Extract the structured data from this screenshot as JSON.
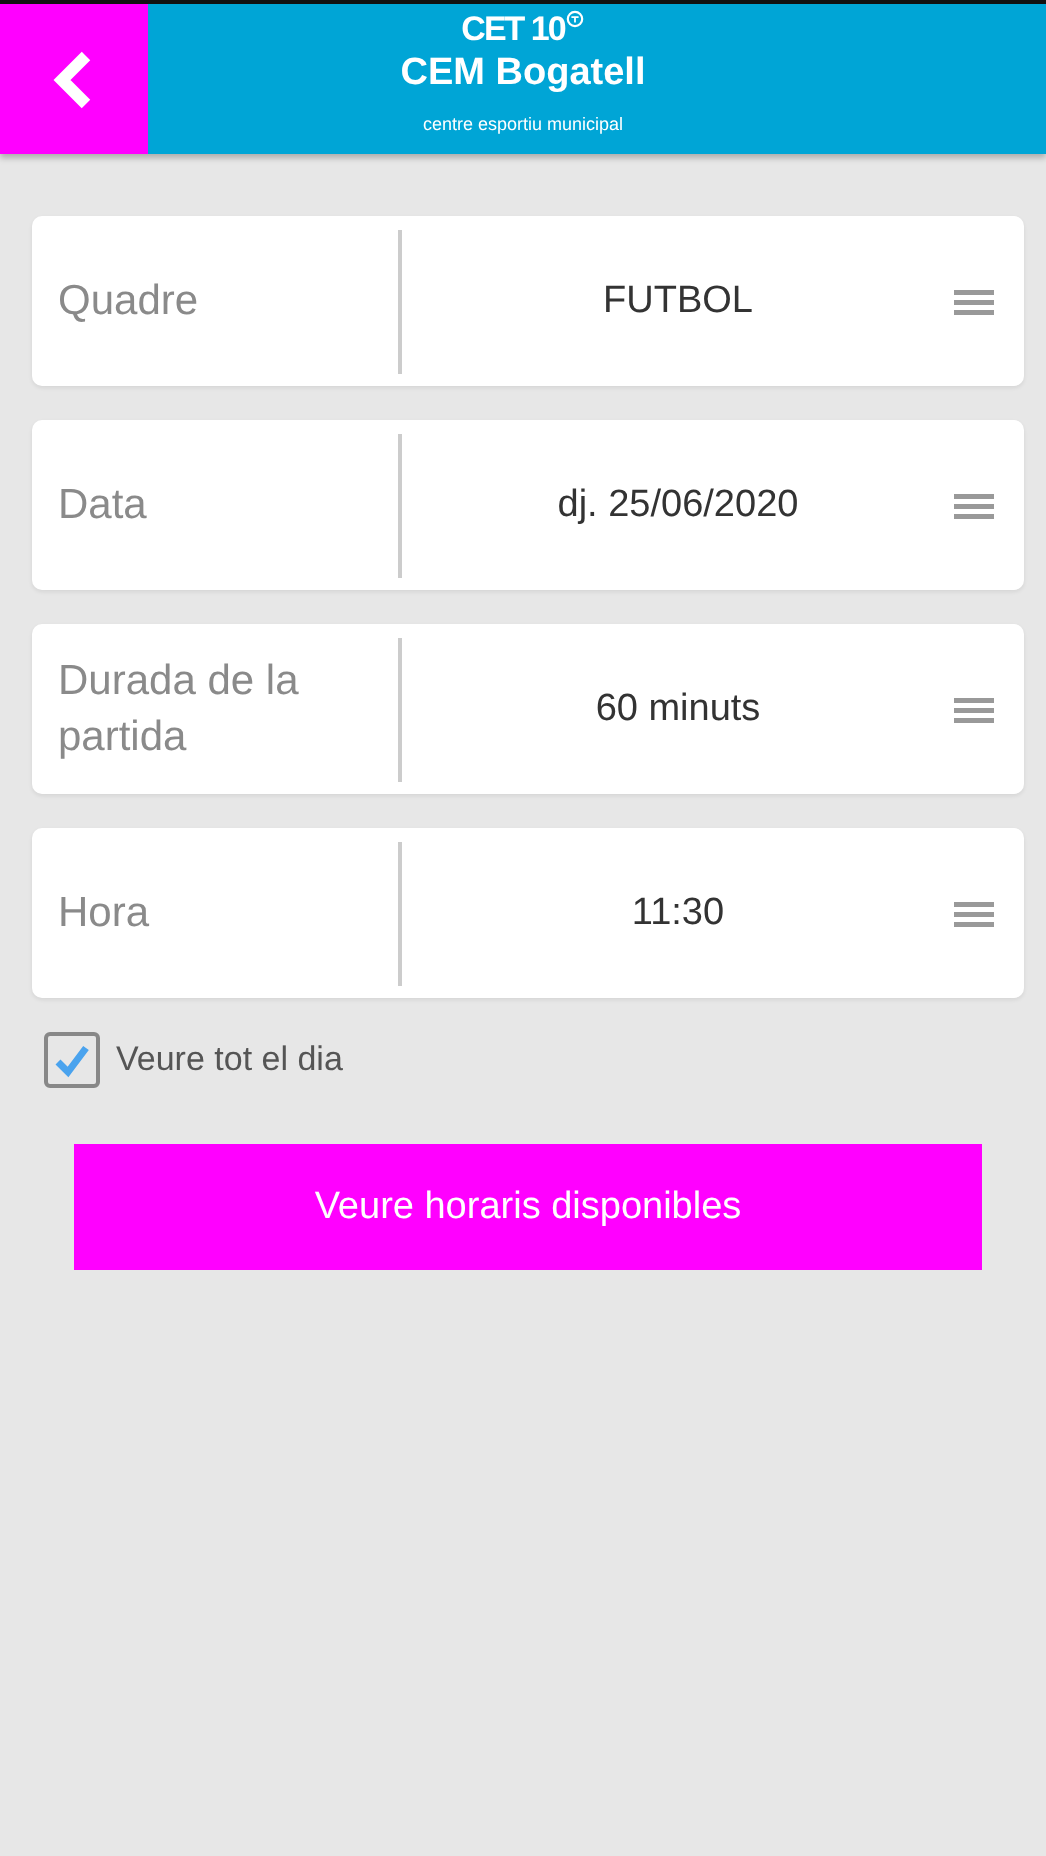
{
  "header": {
    "logo": "CET 10",
    "title": "CEM Bogatell",
    "subtitle": "centre esportiu municipal"
  },
  "fields": [
    {
      "label": "Quadre",
      "value": "FUTBOL"
    },
    {
      "label": "Data",
      "value": "dj. 25/06/2020"
    },
    {
      "label": "Durada de la partida",
      "value": "60 minuts"
    },
    {
      "label": "Hora",
      "value": "11:30"
    }
  ],
  "all_day": {
    "label": "Veure tot el dia",
    "checked": true
  },
  "submit": "Veure horaris disponibles"
}
